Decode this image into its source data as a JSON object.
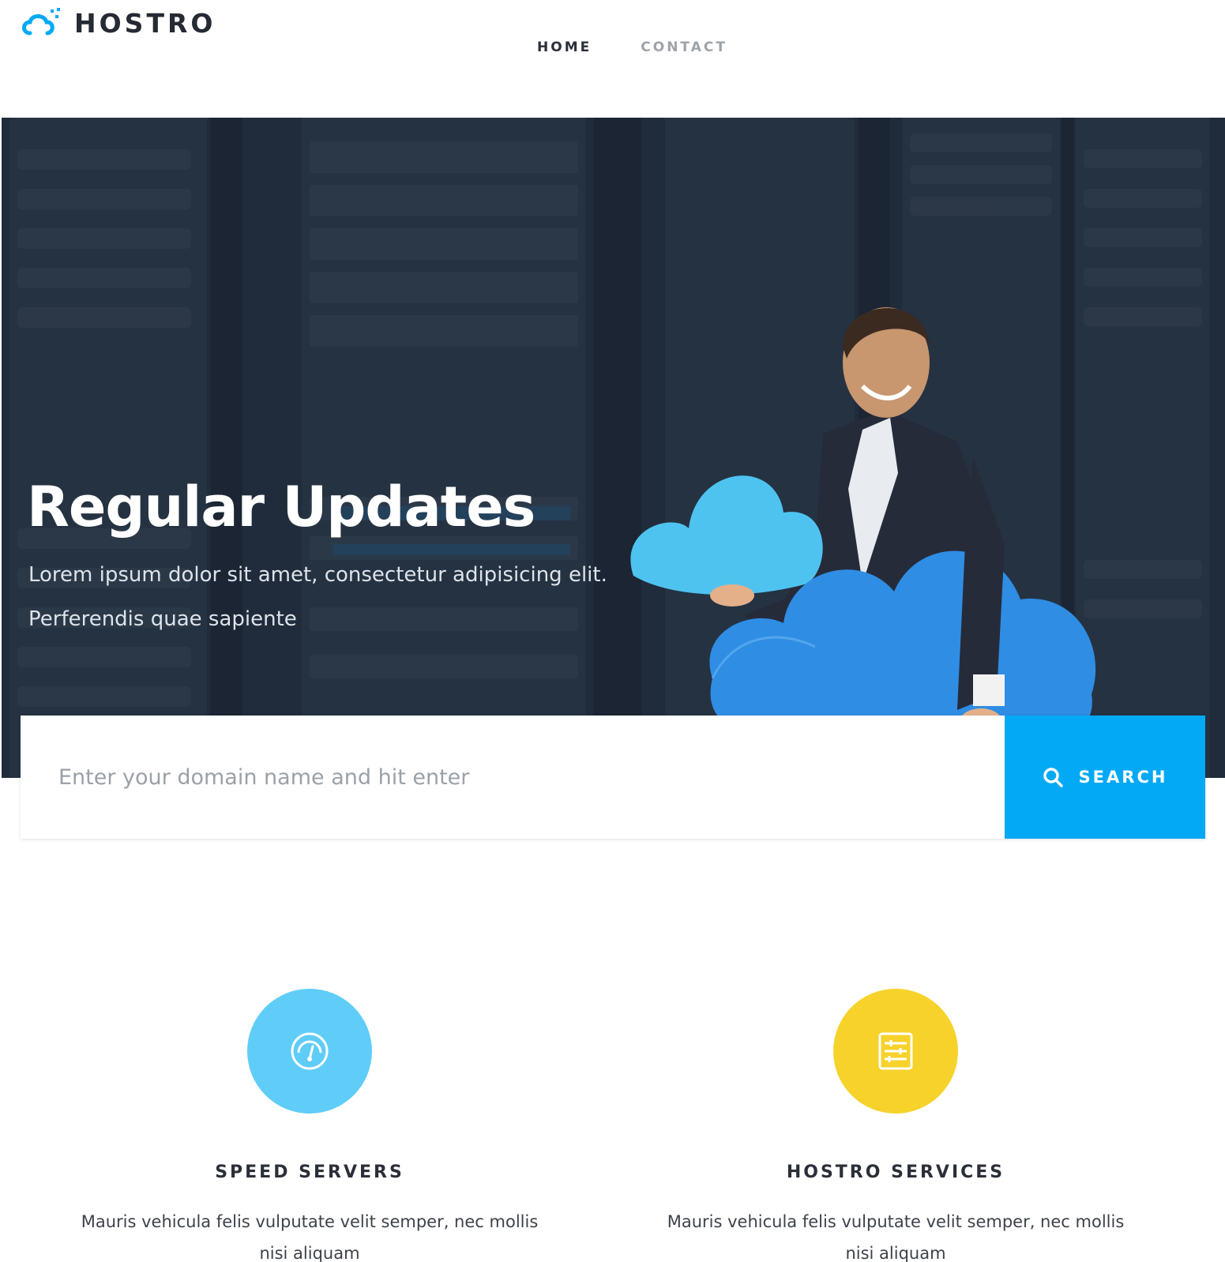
{
  "brand": {
    "name": "HOSTRO",
    "accent": "#03a9f4"
  },
  "nav": {
    "items": [
      {
        "label": "HOME",
        "active": true
      },
      {
        "label": "CONTACT",
        "active": false
      }
    ]
  },
  "hero": {
    "title": "Regular Updates",
    "subtitle_line1": "Lorem ipsum dolor sit amet, consectetur adipisicing elit.",
    "subtitle_line2": "Perferendis quae sapiente"
  },
  "search": {
    "placeholder": "Enter your domain name and hit enter",
    "button_label": "SEARCH",
    "button_icon": "search-icon",
    "button_color": "#03a9f4"
  },
  "features": [
    {
      "title": "SPEED SERVERS",
      "text": "Mauris vehicula felis vulputate velit semper, nec mollis nisi aliquam",
      "icon": "speedometer-icon",
      "color": "#5fcdf8"
    },
    {
      "title": "HOSTRO SERVICES",
      "text": "Mauris vehicula felis vulputate velit semper, nec mollis nisi aliquam",
      "icon": "settings-sliders-icon",
      "color": "#f7d22b"
    }
  ]
}
